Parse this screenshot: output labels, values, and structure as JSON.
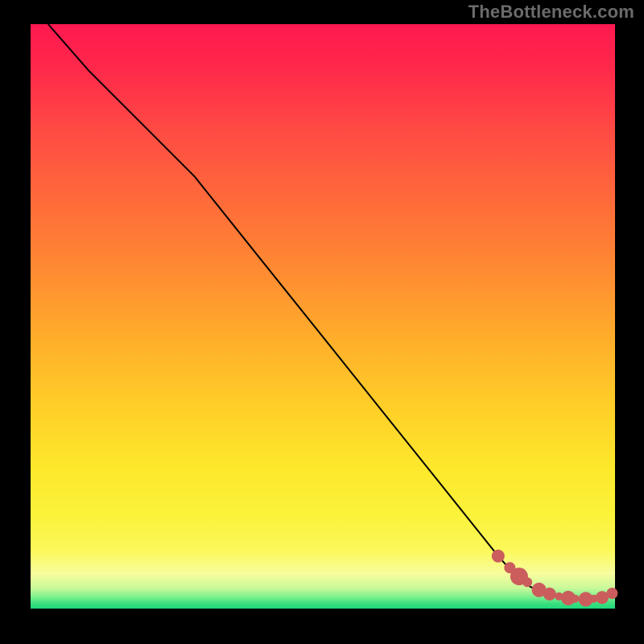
{
  "watermark": "TheBottleneck.com",
  "colors": {
    "dot": "#cb5d5c",
    "curve": "#000000"
  },
  "chart_data": {
    "type": "line",
    "title": "",
    "xlabel": "",
    "ylabel": "",
    "xlim": [
      0,
      100
    ],
    "ylim": [
      0,
      100
    ],
    "grid": false,
    "series": [
      {
        "name": "bottleneck-curve",
        "x": [
          3,
          10,
          20,
          28,
          40,
          50,
          60,
          70,
          80,
          84,
          88,
          92,
          95,
          97.5,
          99.5
        ],
        "y": [
          100,
          92,
          82,
          74,
          59,
          46.5,
          34,
          21.5,
          9,
          4.5,
          2.5,
          1.7,
          1.6,
          1.8,
          2.6
        ]
      }
    ],
    "markers": {
      "name": "highlight-dots",
      "x": [
        80.0,
        82.0,
        83.6,
        85.0,
        87.0,
        88.8,
        90.4,
        92.0,
        93.2,
        95.0,
        96.4,
        97.8,
        99.5
      ],
      "y": [
        9.0,
        7.0,
        5.5,
        4.5,
        3.2,
        2.5,
        2.1,
        1.8,
        1.7,
        1.6,
        1.7,
        1.9,
        2.6
      ],
      "r": [
        8,
        7,
        11,
        6,
        9,
        8,
        5,
        9,
        5,
        9,
        5,
        8,
        7
      ]
    }
  }
}
